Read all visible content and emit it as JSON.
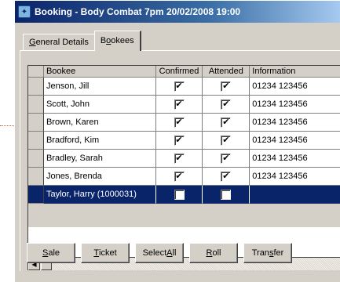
{
  "window": {
    "title": "Booking - Body Combat 7pm 20/02/2008 19:00"
  },
  "tabs": [
    {
      "label": "General Details",
      "mnemonic_prefix": "",
      "mnemonic": "G",
      "rest": "eneral Details"
    },
    {
      "label": "Bookees",
      "mnemonic_prefix": "B",
      "mnemonic": "o",
      "rest": "okees"
    }
  ],
  "grid": {
    "columns": [
      "Bookee",
      "Confirmed",
      "Attended",
      "Information"
    ],
    "rows": [
      {
        "bookee": "Jenson, Jill",
        "confirmed": "✔",
        "attended": "✔",
        "info": "01234 123456"
      },
      {
        "bookee": "Scott, John",
        "confirmed": "✔",
        "attended": "✔",
        "info": "01234 123456"
      },
      {
        "bookee": "Brown, Karen",
        "confirmed": "✔",
        "attended": "✔",
        "info": "01234 123456"
      },
      {
        "bookee": "Bradford, Kim",
        "confirmed": "✔",
        "attended": "✔",
        "info": "01234 123456"
      },
      {
        "bookee": "Bradley, Sarah",
        "confirmed": "✔",
        "attended": "✔",
        "info": "01234 123456"
      },
      {
        "bookee": "Jones, Brenda",
        "confirmed": "✔",
        "attended": "✔",
        "info": "01234 123456"
      },
      {
        "bookee": "Taylor, Harry (1000031)",
        "confirmed": "",
        "attended": "",
        "info": ""
      }
    ]
  },
  "buttons": [
    {
      "pre": "",
      "mn": "S",
      "post": "ale"
    },
    {
      "pre": "",
      "mn": "T",
      "post": "icket"
    },
    {
      "pre": "Select ",
      "mn": "A",
      "post": "ll"
    },
    {
      "pre": "",
      "mn": "R",
      "post": "oll"
    },
    {
      "pre": "Tran",
      "mn": "s",
      "post": "fer"
    }
  ],
  "scroll": {
    "left_arrow": "◀"
  },
  "colors": {
    "title_start": "#0a246a",
    "selection": "#0a246a",
    "face": "#d4d0c8"
  }
}
